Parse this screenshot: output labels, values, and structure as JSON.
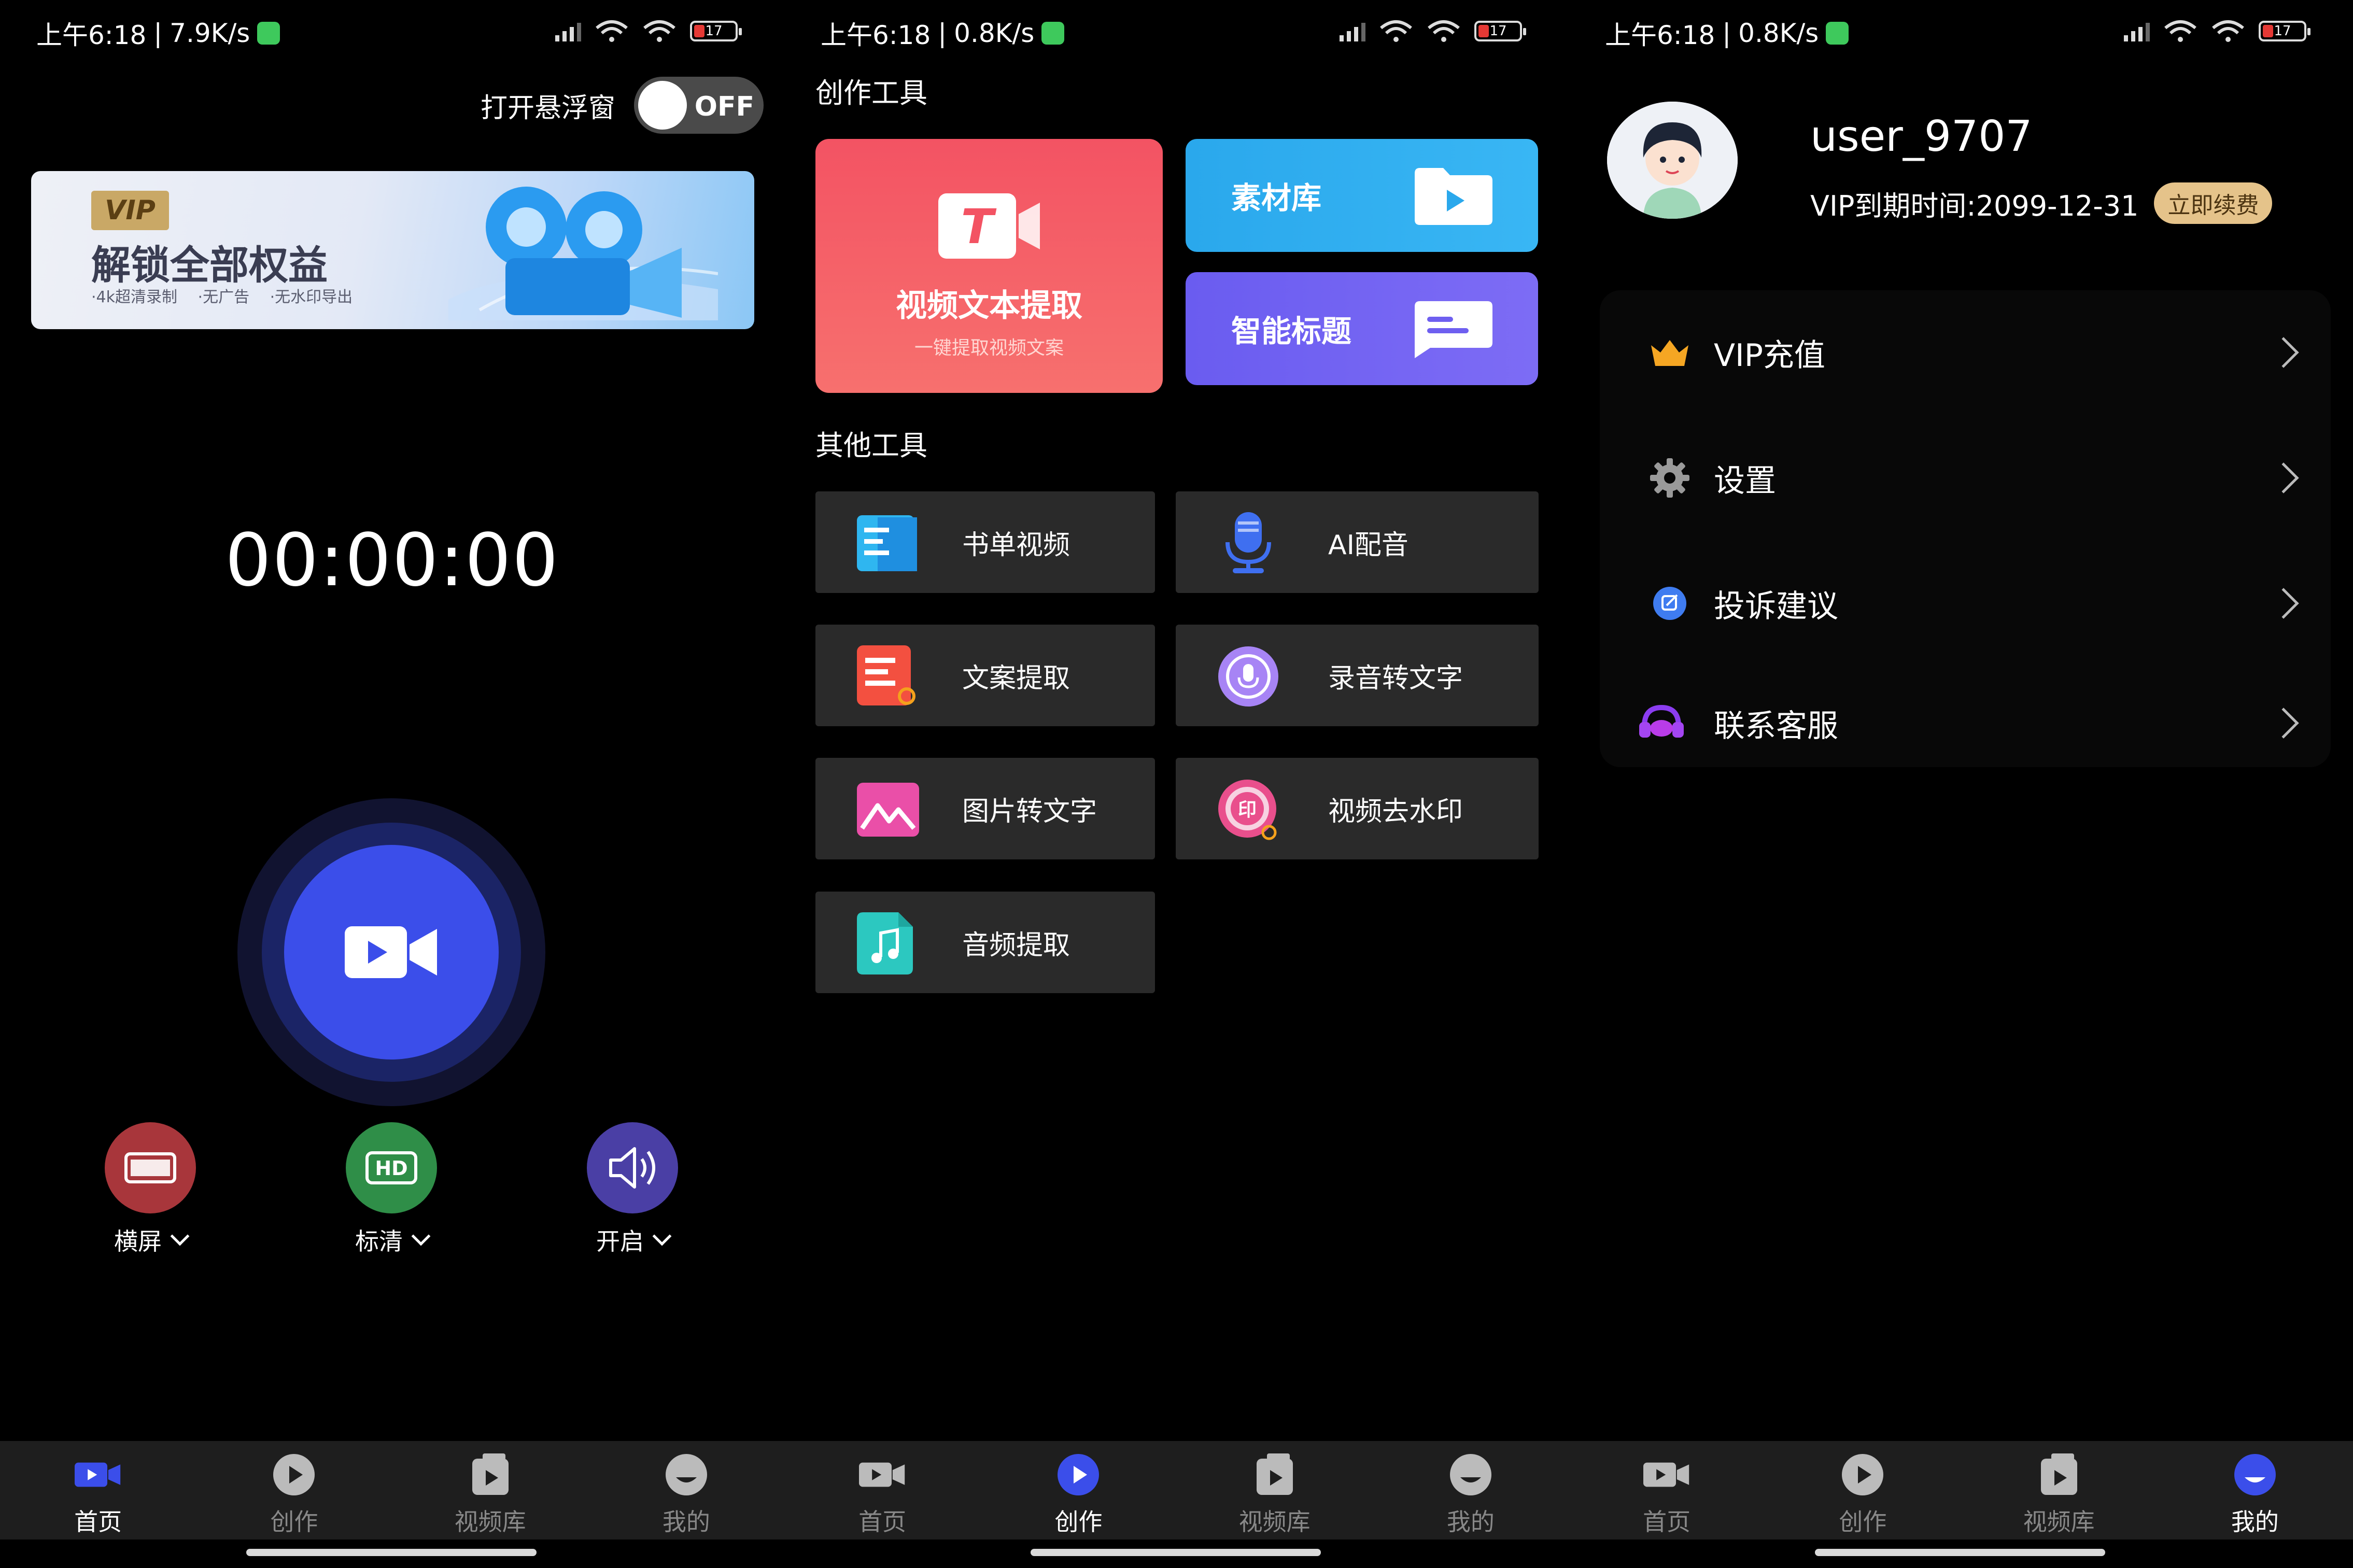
{
  "screens": {
    "home": {
      "status": {
        "time": "上午6:18",
        "speed": "7.9K/s",
        "battery": "17"
      },
      "float_label": "打开悬浮窗",
      "toggle_text": "OFF",
      "banner": {
        "tag": "VIP",
        "title": "解锁全部权益",
        "sub": "·4k超清录制  ·无广告  ·无水印导出"
      },
      "timer": "00:00:00",
      "options": [
        {
          "label": "横屏",
          "color": "#a8363b",
          "icon": "landscape-icon"
        },
        {
          "label": "标清",
          "color": "#2f8e48",
          "icon": "hd-icon"
        },
        {
          "label": "开启",
          "color": "#4a3fa5",
          "icon": "speaker-icon"
        }
      ]
    },
    "create": {
      "status": {
        "time": "上午6:18",
        "speed": "0.8K/s",
        "battery": "17"
      },
      "section_creation": "创作工具",
      "big_card": {
        "title": "视频文本提取",
        "sub": "一键提取视频文案"
      },
      "material": "素材库",
      "smart_title": "智能标题",
      "section_other": "其他工具",
      "tools": [
        "书单视频",
        "AI配音",
        "文案提取",
        "录音转文字",
        "图片转文字",
        "视频去水印",
        "音频提取"
      ]
    },
    "mine": {
      "status": {
        "time": "上午6:18",
        "speed": "0.8K/s",
        "battery": "17"
      },
      "username": "user_9707",
      "vip_expire": "VIP到期时间:2099-12-31",
      "renew": "立即续费",
      "menu": [
        "VIP充值",
        "设置",
        "投诉建议",
        "联系客服"
      ]
    }
  },
  "tabs": [
    "首页",
    "创作",
    "视频库",
    "我的"
  ],
  "colors": {
    "accent": "#3b4eea",
    "card_red": "#f35363",
    "card_blue": "#2aa8ec",
    "card_purple": "#6e5ff0",
    "tool_bg": "#2a2a2a",
    "vip_gold": "#e5c38a"
  }
}
